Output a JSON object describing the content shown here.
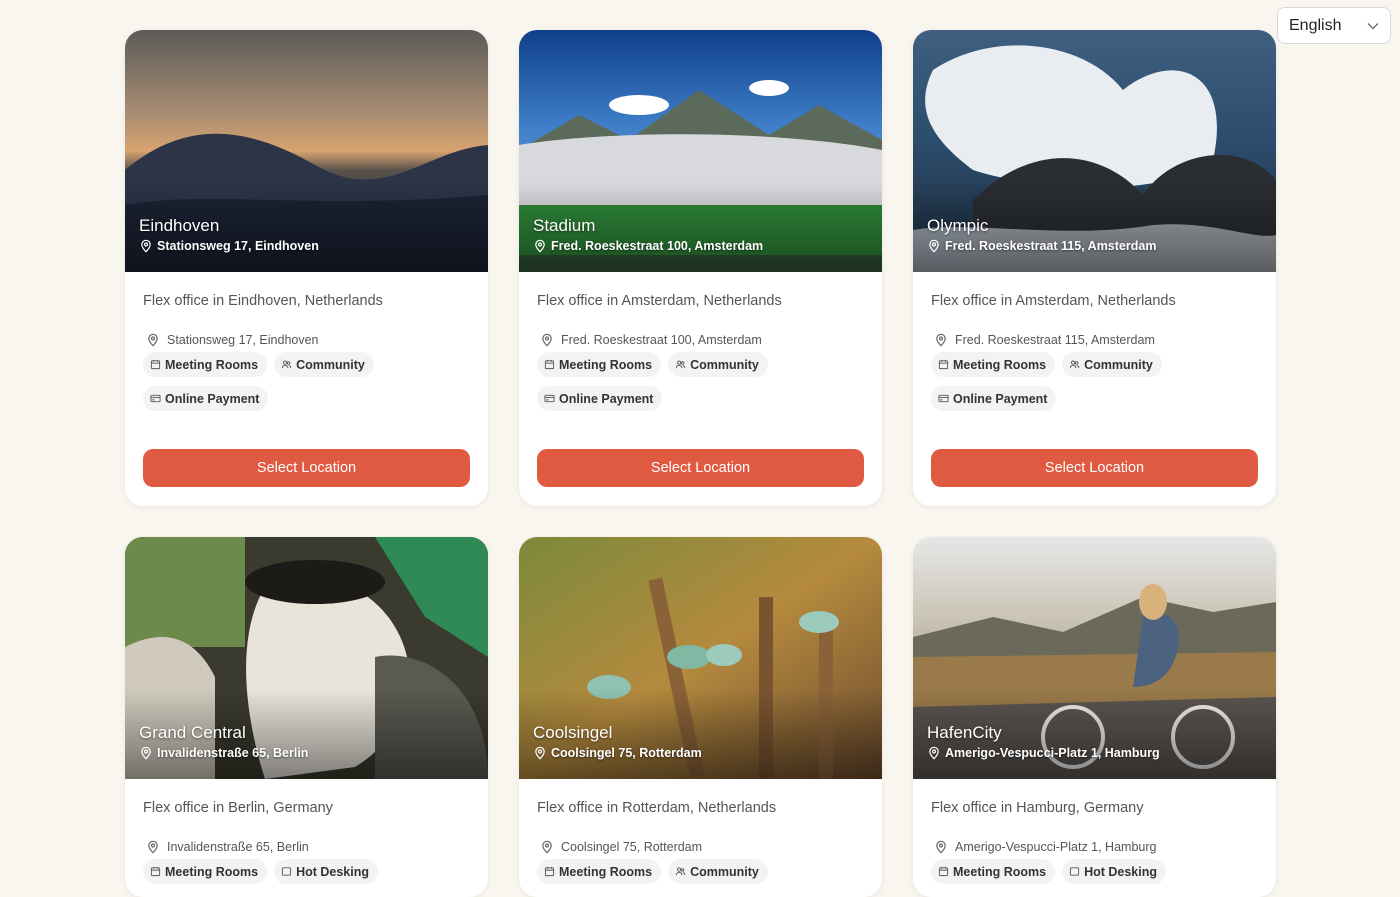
{
  "language": {
    "selected": "English"
  },
  "select_label": "Select Location",
  "locations": [
    {
      "name": "Eindhoven",
      "address": "Stationsweg 17, Eindhoven",
      "subtitle": "Flex office in Eindhoven, Netherlands",
      "amenities": [
        {
          "label": "Meeting Rooms",
          "icon": "calendar-icon"
        },
        {
          "label": "Community",
          "icon": "people-icon"
        },
        {
          "label": "Online Payment",
          "icon": "credit-card-icon"
        }
      ]
    },
    {
      "name": "Stadium",
      "address": "Fred. Roeskestraat 100, Amsterdam",
      "subtitle": "Flex office in Amsterdam, Netherlands",
      "amenities": [
        {
          "label": "Meeting Rooms",
          "icon": "calendar-icon"
        },
        {
          "label": "Community",
          "icon": "people-icon"
        },
        {
          "label": "Online Payment",
          "icon": "credit-card-icon"
        }
      ]
    },
    {
      "name": "Olympic",
      "address": "Fred. Roeskestraat 115, Amsterdam",
      "subtitle": "Flex office in Amsterdam, Netherlands",
      "amenities": [
        {
          "label": "Meeting Rooms",
          "icon": "calendar-icon"
        },
        {
          "label": "Community",
          "icon": "people-icon"
        },
        {
          "label": "Online Payment",
          "icon": "credit-card-icon"
        }
      ]
    },
    {
      "name": "Grand Central",
      "address": "Invalidenstraße 65, Berlin",
      "subtitle": "Flex office in Berlin, Germany",
      "amenities": [
        {
          "label": "Meeting Rooms",
          "icon": "calendar-icon"
        },
        {
          "label": "Hot Desking",
          "icon": "desk-icon"
        }
      ]
    },
    {
      "name": "Coolsingel",
      "address": "Coolsingel 75, Rotterdam",
      "subtitle": "Flex office in Rotterdam, Netherlands",
      "amenities": [
        {
          "label": "Meeting Rooms",
          "icon": "calendar-icon"
        },
        {
          "label": "Community",
          "icon": "people-icon"
        }
      ]
    },
    {
      "name": "HafenCity",
      "address": "Amerigo-Vespucci-Platz 1, Hamburg",
      "subtitle": "Flex office in Hamburg, Germany",
      "amenities": [
        {
          "label": "Meeting Rooms",
          "icon": "calendar-icon"
        },
        {
          "label": "Hot Desking",
          "icon": "desk-icon"
        }
      ]
    }
  ]
}
